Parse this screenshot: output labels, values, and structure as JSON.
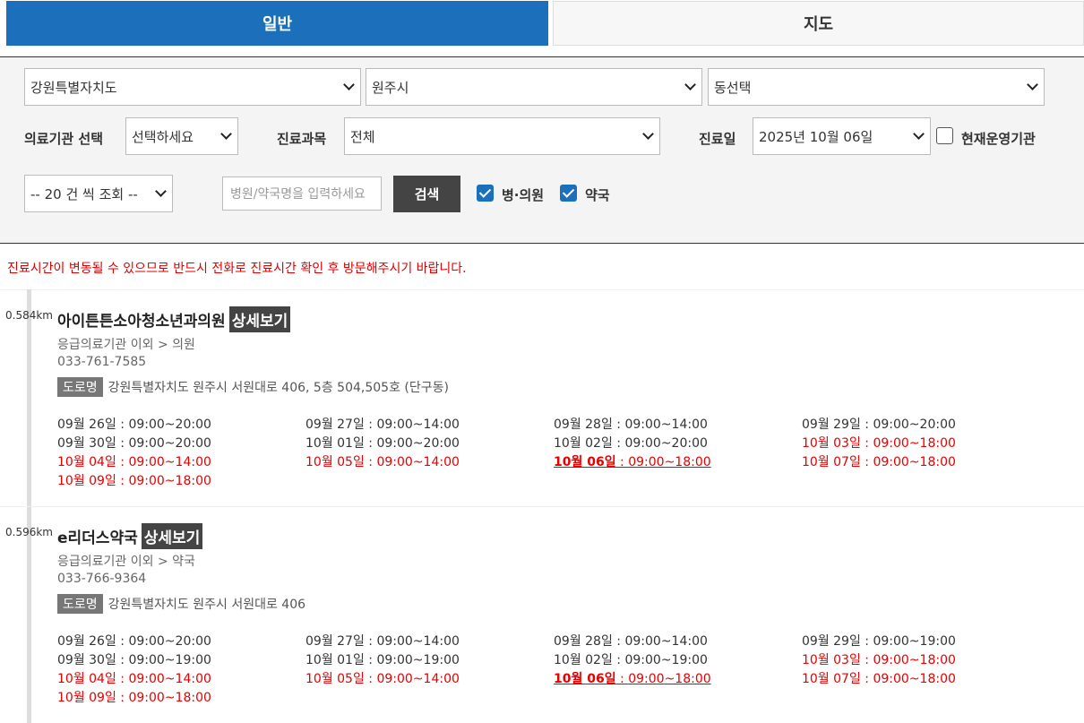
{
  "tabs": {
    "general": "일반",
    "map": "지도"
  },
  "filters": {
    "province": "강원특별자치도",
    "city": "원주시",
    "dong": "동선택",
    "institution_label": "의료기관 선택",
    "institution_value": "선택하세요",
    "dept_label": "진료과목",
    "dept_value": "전체",
    "date_label": "진료일",
    "date_value": "2025년 10월 06일",
    "open_now_label": "현재운영기관",
    "open_now_checked": false,
    "page_size": "-- 20 건 씩 조회 --",
    "search_placeholder": "병원/약국명을 입력하세요",
    "search_button": "검색",
    "hospital_label": "병·의원",
    "hospital_checked": true,
    "pharmacy_label": "약국",
    "pharmacy_checked": true
  },
  "notice": "진료시간이 변동될 수 있으므로 반드시 전화로 진료시간 확인 후 방문해주시기 바랍니다.",
  "results": [
    {
      "distance": "0.584km",
      "name": "아이튼튼소아청소년과의원",
      "detail_button": "상세보기",
      "category": "응급의료기관 이외 > 의원",
      "phone": "033-761-7585",
      "addr_tag": "도로명",
      "address": "강원특별자치도 원주시 서원대로 406, 5층 504,505호 (단구동)",
      "schedule": [
        {
          "day": "09월 26일",
          "time": " : 09:00~20:00",
          "style": "normal"
        },
        {
          "day": "09월 27일",
          "time": " : 09:00~14:00",
          "style": "normal"
        },
        {
          "day": "09월 28일",
          "time": " : 09:00~14:00",
          "style": "normal"
        },
        {
          "day": "09월 29일",
          "time": " : 09:00~20:00",
          "style": "normal"
        },
        {
          "day": "09월 30일",
          "time": " : 09:00~20:00",
          "style": "normal"
        },
        {
          "day": "10월 01일",
          "time": " : 09:00~20:00",
          "style": "normal"
        },
        {
          "day": "10월 02일",
          "time": " : 09:00~20:00",
          "style": "normal"
        },
        {
          "day": "10월 03일",
          "time": " : 09:00~18:00",
          "style": "red"
        },
        {
          "day": "10월 04일",
          "time": " : 09:00~14:00",
          "style": "red"
        },
        {
          "day": "10월 05일",
          "time": " : 09:00~14:00",
          "style": "red"
        },
        {
          "day": "10월 06일",
          "time": " : 09:00~18:00",
          "style": "today"
        },
        {
          "day": "10월 07일",
          "time": " : 09:00~18:00",
          "style": "red"
        },
        {
          "day": "10월 09일",
          "time": " : 09:00~18:00",
          "style": "red"
        }
      ]
    },
    {
      "distance": "0.596km",
      "name": "e리더스약국",
      "detail_button": "상세보기",
      "category": "응급의료기관 이외 > 약국",
      "phone": "033-766-9364",
      "addr_tag": "도로명",
      "address": "강원특별자치도 원주시 서원대로 406",
      "schedule": [
        {
          "day": "09월 26일",
          "time": " : 09:00~20:00",
          "style": "normal"
        },
        {
          "day": "09월 27일",
          "time": " : 09:00~14:00",
          "style": "normal"
        },
        {
          "day": "09월 28일",
          "time": " : 09:00~14:00",
          "style": "normal"
        },
        {
          "day": "09월 29일",
          "time": " : 09:00~19:00",
          "style": "normal"
        },
        {
          "day": "09월 30일",
          "time": " : 09:00~19:00",
          "style": "normal"
        },
        {
          "day": "10월 01일",
          "time": " : 09:00~19:00",
          "style": "normal"
        },
        {
          "day": "10월 02일",
          "time": " : 09:00~19:00",
          "style": "normal"
        },
        {
          "day": "10월 03일",
          "time": " : 09:00~18:00",
          "style": "red"
        },
        {
          "day": "10월 04일",
          "time": " : 09:00~14:00",
          "style": "red"
        },
        {
          "day": "10월 05일",
          "time": " : 09:00~14:00",
          "style": "red"
        },
        {
          "day": "10월 06일",
          "time": " : 09:00~18:00",
          "style": "today"
        },
        {
          "day": "10월 07일",
          "time": " : 09:00~18:00",
          "style": "red"
        },
        {
          "day": "10월 09일",
          "time": " : 09:00~18:00",
          "style": "red"
        }
      ]
    }
  ]
}
